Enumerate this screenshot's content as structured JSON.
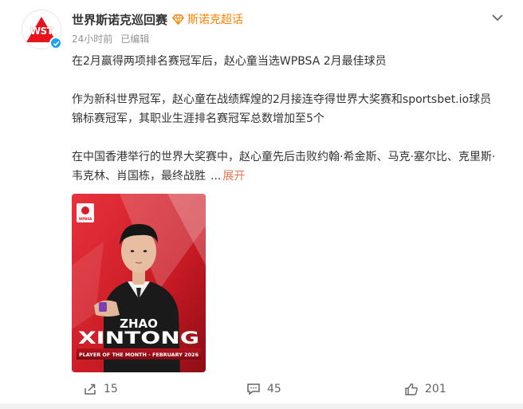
{
  "post": {
    "author": "世界斯诺克巡回赛",
    "fan_badge": "斯诺克超话",
    "time": "24小时前",
    "edited": "已编辑",
    "avatar_text": "WST",
    "paragraphs": [
      "在2月赢得两项排名赛冠军后，赵心童当选WPBSA 2月最佳球员",
      "作为新科世界冠军，赵心童在战绩辉煌的2月接连夺得世界大奖赛和sportsbet.io球员锦标赛冠军，其职业生涯排名赛冠军总数增加至5个",
      "在中国香港举行的世界大奖赛中，赵心童先后击败约翰·希金斯、马克·塞尔比、克里斯·韦克林、肖国栋，最终战胜"
    ],
    "ellipsis": "...",
    "expand_label": "展开"
  },
  "image": {
    "logo_text": "WPBSA",
    "name_line1": "ZHAO",
    "name_line2": "XINTONG",
    "banner": "PLAYER OF THE MONTH - FEBRUARY 2026",
    "bg_color": "#d41f2a"
  },
  "actions": {
    "share_count": "15",
    "comment_count": "45",
    "like_count": "201"
  },
  "colors": {
    "accent": "#eb7350",
    "badge": "#ff8200",
    "verified": "#1da1f2"
  }
}
